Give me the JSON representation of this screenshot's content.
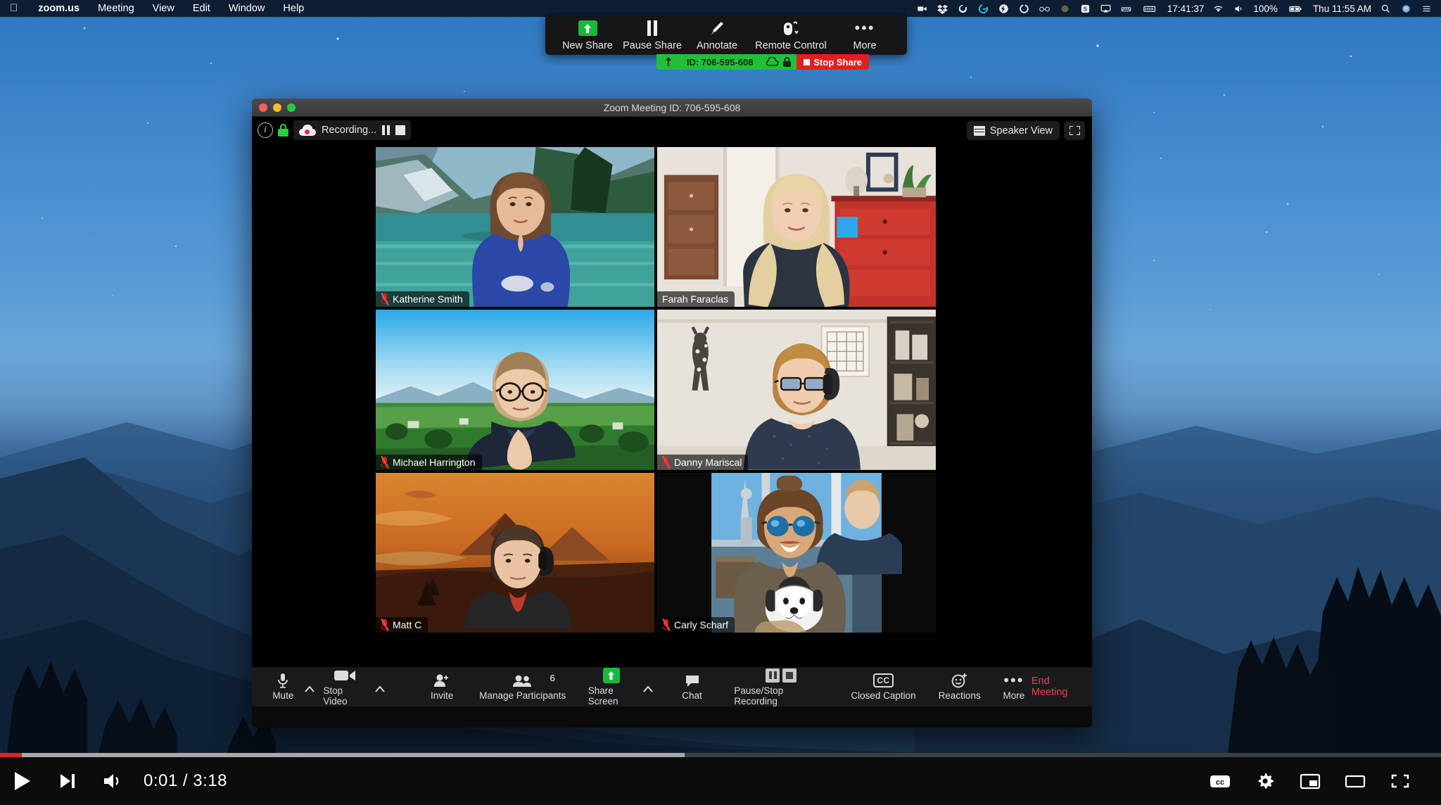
{
  "menubar": {
    "apple_icon": "apple-logo-icon",
    "items": [
      {
        "label": "zoom.us",
        "bold": true
      },
      {
        "label": "Meeting",
        "bold": false
      },
      {
        "label": "View",
        "bold": false
      },
      {
        "label": "Edit",
        "bold": false
      },
      {
        "label": "Window",
        "bold": false
      },
      {
        "label": "Help",
        "bold": false
      }
    ],
    "status_icons": [
      "video-camera-icon",
      "dropbox-icon",
      "sync-icon",
      "grammarly-icon",
      "flash-icon",
      "cleaner-icon",
      "glasses-icon",
      "circle-icon",
      "s-app-icon",
      "airplay-icon",
      "keyboard-tray-icon",
      "battery-meter-icon"
    ],
    "timer": "17:41:37",
    "wifi_icon": "wifi-icon",
    "volume_icon": "volume-icon",
    "battery_percent": "100%",
    "battery_icon": "battery-charging-icon",
    "clock": "Thu 11:55 AM",
    "search_icon": "spotlight-search-icon",
    "siri_icon": "siri-icon",
    "notification_icon": "notification-center-icon"
  },
  "share_toolbar": {
    "buttons": [
      {
        "label": "New Share",
        "icon": "green-up-arrow-icon"
      },
      {
        "label": "Pause Share",
        "icon": "pause-icon"
      },
      {
        "label": "Annotate",
        "icon": "pencil-icon"
      },
      {
        "label": "Remote Control",
        "icon": "mouse-icon"
      },
      {
        "label": "More",
        "icon": "ellipsis-icon"
      }
    ],
    "strip": {
      "share_arrow_icon": "share-arrow-icon",
      "meeting_id": "ID: 706-595-608",
      "cloud_icon": "cloud-icon",
      "lock_icon": "lock-icon",
      "stop_label": "Stop Share"
    }
  },
  "zoom_window": {
    "title": "Zoom Meeting ID: 706-595-608",
    "traffic_lights": [
      "close-button",
      "minimize-button",
      "maximize-button"
    ],
    "top_left": {
      "info_icon": "info-icon",
      "encryption_icon": "green-lock-icon",
      "recording_icon": "cloud-recording-icon",
      "recording_label": "Recording...",
      "pause_icon": "pause-recording-icon",
      "stop_icon": "stop-recording-icon"
    },
    "top_right": {
      "view_icon": "gallery-grid-icon",
      "view_label": "Speaker View",
      "fullscreen_icon": "enter-fullscreen-icon"
    },
    "participants": [
      {
        "name": "Katherine Smith",
        "muted": true,
        "active_speaker": false,
        "bg": "lake-mountain-virtual-background"
      },
      {
        "name": "Farah Faraclas",
        "muted": false,
        "active_speaker": false,
        "bg": "home-room-red-dresser"
      },
      {
        "name": "Michael Harrington",
        "muted": true,
        "active_speaker": false,
        "bg": "green-valley-virtual-background"
      },
      {
        "name": "Danny Mariscal",
        "muted": true,
        "active_speaker": false,
        "bg": "white-wall-office"
      },
      {
        "name": "Matt C",
        "muted": true,
        "active_speaker": false,
        "bg": "orange-mountain-virtual-background"
      },
      {
        "name": "Carly Scharf",
        "muted": true,
        "active_speaker": true,
        "bg": "outdoor-window-city"
      }
    ],
    "toolbar": {
      "mute_label": "Mute",
      "mute_icon": "microphone-icon",
      "stop_video_label": "Stop Video",
      "stop_video_icon": "video-camera-icon",
      "invite_label": "Invite",
      "invite_icon": "person-add-icon",
      "participants_label": "Manage Participants",
      "participants_icon": "people-icon",
      "participants_count": "6",
      "share_label": "Share Screen",
      "share_icon": "green-share-icon",
      "chat_label": "Chat",
      "chat_icon": "chat-bubble-icon",
      "recording_label": "Pause/Stop Recording",
      "recording_icon": "pause-stop-recording-icon",
      "cc_label": "Closed Caption",
      "cc_icon": "cc-icon",
      "reactions_label": "Reactions",
      "reactions_icon": "smiley-plus-icon",
      "more_label": "More",
      "more_icon": "ellipsis-icon",
      "end_label": "End Meeting"
    }
  },
  "player": {
    "play_icon": "play-icon",
    "next_icon": "next-track-icon",
    "volume_icon": "volume-on-icon",
    "time": "0:01 / 3:18",
    "played_percent": 1.5,
    "buffered_percent": 47.5,
    "cc_icon": "closed-caption-icon",
    "settings_icon": "gear-icon",
    "miniplayer_icon": "miniplayer-icon",
    "theater_icon": "theater-mode-icon",
    "fullscreen_icon": "fullscreen-icon"
  },
  "colors": {
    "share_green": "#22c03a",
    "stop_red": "#e02020",
    "active_speaker": "#d4e157",
    "end_meeting_red": "#e8414a",
    "progress_red": "#e62117"
  }
}
